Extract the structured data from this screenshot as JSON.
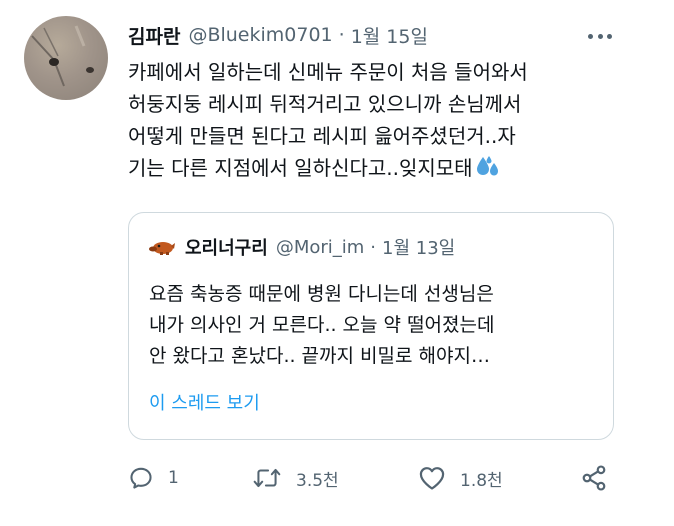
{
  "author": {
    "display_name": "김파란",
    "handle": "@Bluekim0701",
    "separator": "·",
    "timestamp": "1월 15일"
  },
  "body_lines": [
    "카페에서 일하는데 신메뉴 주문이 처음 들어와서",
    "허둥지둥 레시피 뒤적거리고 있으니까 손님께서",
    "어떻게 만들면 된다고 레시피 읊어주셨던거..자",
    "기는 다른 지점에서 일하신다고..잊지모태"
  ],
  "quoted": {
    "display_name": "오리너구리",
    "handle": "@Mori_im",
    "separator": "·",
    "timestamp": "1월 13일",
    "lines": [
      "요즘 축농증 때문에 병원 다니는데 선생님은",
      "내가 의사인 거 모른다.. 오늘 약 떨어졌는데",
      "안 왔다고 혼났다.. 끝까지 비밀로 해야지…"
    ],
    "show_thread": "이 스레드 보기"
  },
  "actions": {
    "reply_count": "1",
    "retweet_count": "3.5천",
    "like_count": "1.8천"
  },
  "icons": [
    "more-icon",
    "sweat-droplets-icon",
    "platypus-avatar-icon",
    "reply-icon",
    "retweet-icon",
    "like-icon",
    "share-icon"
  ],
  "colors": {
    "text": "#0f1419",
    "secondary": "#536471",
    "link": "#1d9bf0",
    "border": "#cfd9de",
    "emoji": "#4fa3e0"
  }
}
